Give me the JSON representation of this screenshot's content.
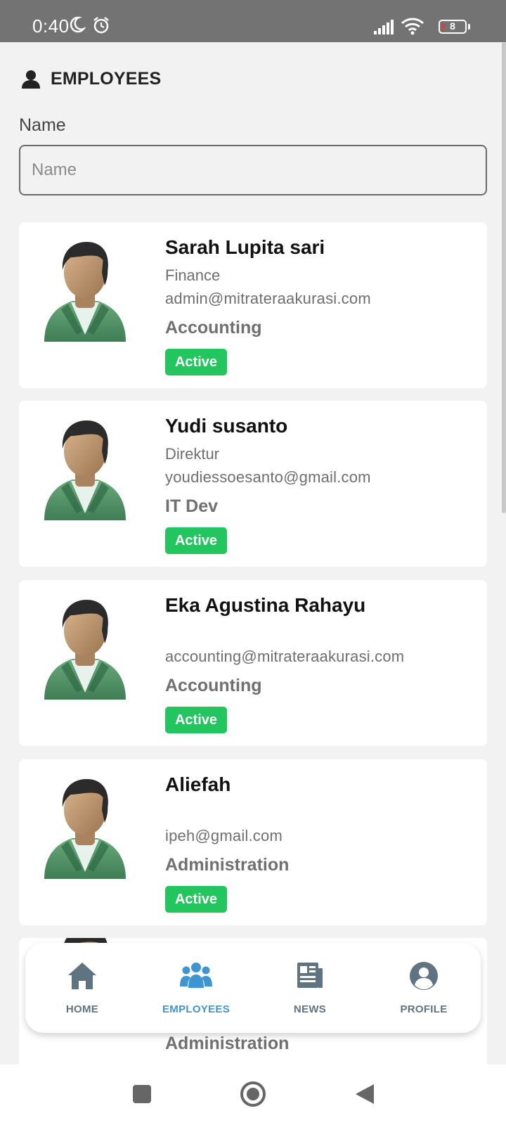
{
  "status_bar": {
    "time": "0:40",
    "battery": "8"
  },
  "header": {
    "title": "EMPLOYEES"
  },
  "search": {
    "label": "Name",
    "placeholder": "Name",
    "value": ""
  },
  "employees": [
    {
      "name": "Sarah Lupita sari",
      "role": "Finance",
      "email": "admin@mitrateraakurasi.com",
      "department": "Accounting",
      "status": "Active"
    },
    {
      "name": "Yudi susanto",
      "role": "Direktur",
      "email": "youdiessoesanto@gmail.com",
      "department": "IT Dev",
      "status": "Active"
    },
    {
      "name": "Eka Agustina Rahayu",
      "role": "",
      "email": "accounting@mitrateraakurasi.com",
      "department": "Accounting",
      "status": "Active"
    },
    {
      "name": "Aliefah",
      "role": "",
      "email": "ipeh@gmail.com",
      "department": "Administration",
      "status": "Active"
    },
    {
      "department": "Administration"
    }
  ],
  "bottom_nav": {
    "items": [
      {
        "label": "HOME",
        "icon": "home-icon",
        "active": false
      },
      {
        "label": "EMPLOYEES",
        "icon": "users-icon",
        "active": true
      },
      {
        "label": "NEWS",
        "icon": "newspaper-icon",
        "active": false
      },
      {
        "label": "PROFILE",
        "icon": "user-circle-icon",
        "active": false
      }
    ]
  },
  "colors": {
    "active_badge": "#22c55e",
    "nav_active": "#3f95d0",
    "nav_inactive": "#5f7380"
  }
}
